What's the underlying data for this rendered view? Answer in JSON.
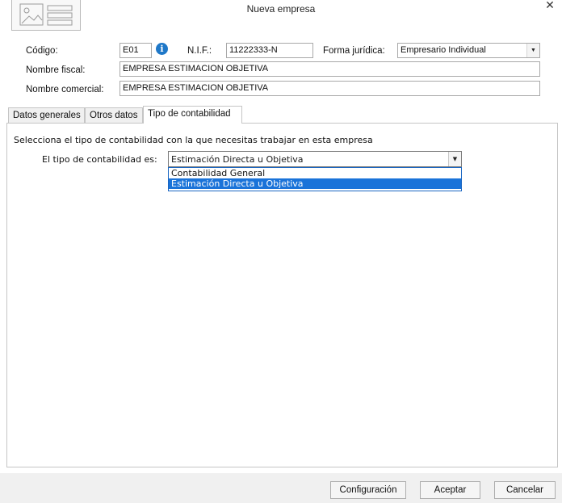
{
  "window": {
    "title": "Nueva empresa",
    "close_glyph": "✕"
  },
  "header": {
    "codigo_label": "Código:",
    "codigo_value": "E01",
    "nif_label": "N.I.F.:",
    "nif_value": "11222333-N",
    "forma_label": "Forma jurídica:",
    "forma_value": "Empresario Individual",
    "fiscal_label": "Nombre fiscal:",
    "fiscal_value": "EMPRESA ESTIMACION OBJETIVA",
    "comercial_label": "Nombre comercial:",
    "comercial_value": "EMPRESA ESTIMACION OBJETIVA",
    "info_glyph": "i"
  },
  "tabs": [
    {
      "label": "Datos generales"
    },
    {
      "label": "Otros datos"
    },
    {
      "label": "Tipo de contabilidad"
    }
  ],
  "panel": {
    "description": "Selecciona el tipo de contabilidad con la que necesitas trabajar en esta empresa",
    "combo_label": "El tipo de contabilidad es:",
    "combo_value": "Estimación Directa u Objetiva",
    "options": [
      {
        "label": "Contabilidad General"
      },
      {
        "label": "Estimación Directa u Objetiva"
      }
    ]
  },
  "footer": {
    "config_label": "Configuración",
    "accept_label": "Aceptar",
    "cancel_label": "Cancelar"
  },
  "colors": {
    "accent": "#1a73d9",
    "info": "#1f78c8"
  }
}
